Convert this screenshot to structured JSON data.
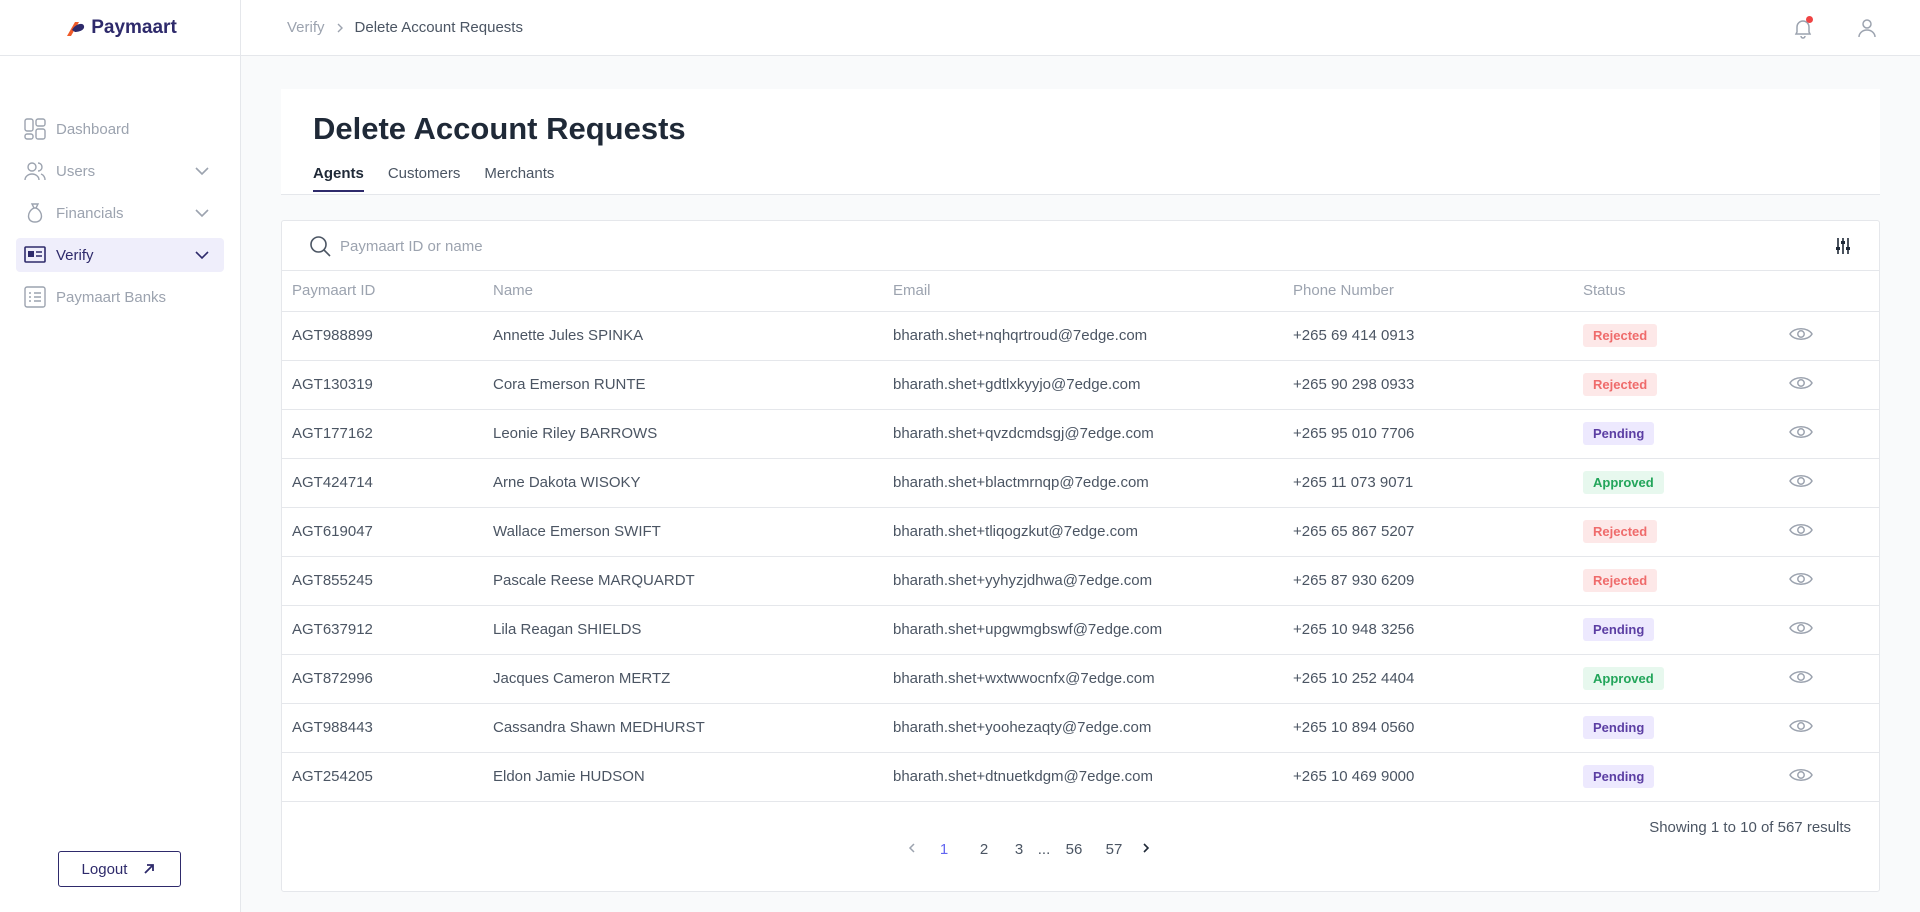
{
  "brand": {
    "name": "Paymaart"
  },
  "sidebar": {
    "items": [
      {
        "label": "Dashboard",
        "icon": "dashboard-icon",
        "has_chevron": false,
        "active": false
      },
      {
        "label": "Users",
        "icon": "users-icon",
        "has_chevron": true,
        "active": false
      },
      {
        "label": "Financials",
        "icon": "money-bag-icon",
        "has_chevron": true,
        "active": false
      },
      {
        "label": "Verify",
        "icon": "id-card-icon",
        "has_chevron": true,
        "active": true
      },
      {
        "label": "Paymaart Banks",
        "icon": "bank-list-icon",
        "has_chevron": false,
        "active": false
      }
    ],
    "logout_label": "Logout"
  },
  "topbar": {
    "breadcrumb": [
      "Verify",
      "Delete Account Requests"
    ]
  },
  "page": {
    "title": "Delete Account Requests",
    "tabs": [
      {
        "label": "Agents",
        "active": true
      },
      {
        "label": "Customers",
        "active": false
      },
      {
        "label": "Merchants",
        "active": false
      }
    ]
  },
  "search": {
    "placeholder": "Paymaart ID or name"
  },
  "table": {
    "headers": [
      "Paymaart ID",
      "Name",
      "Email",
      "Phone Number",
      "Status"
    ],
    "rows": [
      {
        "id": "AGT988899",
        "name": "Annette Jules SPINKA",
        "email": "bharath.shet+nqhqrtroud@7edge.com",
        "phone": "+265 69 414 0913",
        "status": "Rejected"
      },
      {
        "id": "AGT130319",
        "name": "Cora Emerson RUNTE",
        "email": "bharath.shet+gdtlxkyyjo@7edge.com",
        "phone": "+265 90 298 0933",
        "status": "Rejected"
      },
      {
        "id": "AGT177162",
        "name": "Leonie Riley BARROWS",
        "email": "bharath.shet+qvzdcmdsgj@7edge.com",
        "phone": "+265 95 010 7706",
        "status": "Pending"
      },
      {
        "id": "AGT424714",
        "name": "Arne Dakota WISOKY",
        "email": "bharath.shet+blactmrnqp@7edge.com",
        "phone": "+265 11 073 9071",
        "status": "Approved"
      },
      {
        "id": "AGT619047",
        "name": "Wallace Emerson SWIFT",
        "email": "bharath.shet+tliqogzkut@7edge.com",
        "phone": "+265 65 867 5207",
        "status": "Rejected"
      },
      {
        "id": "AGT855245",
        "name": "Pascale Reese MARQUARDT",
        "email": "bharath.shet+yyhyzjdhwa@7edge.com",
        "phone": "+265 87 930 6209",
        "status": "Rejected"
      },
      {
        "id": "AGT637912",
        "name": "Lila Reagan SHIELDS",
        "email": "bharath.shet+upgwmgbswf@7edge.com",
        "phone": "+265 10 948 3256",
        "status": "Pending"
      },
      {
        "id": "AGT872996",
        "name": "Jacques Cameron MERTZ",
        "email": "bharath.shet+wxtwwocnfx@7edge.com",
        "phone": "+265 10 252 4404",
        "status": "Approved"
      },
      {
        "id": "AGT988443",
        "name": "Cassandra Shawn MEDHURST",
        "email": "bharath.shet+yoohezaqty@7edge.com",
        "phone": "+265 10 894 0560",
        "status": "Pending"
      },
      {
        "id": "AGT254205",
        "name": "Eldon Jamie HUDSON",
        "email": "bharath.shet+dtnuetkdgm@7edge.com",
        "phone": "+265 10 469 9000",
        "status": "Pending"
      }
    ]
  },
  "pagination": {
    "pages": [
      "1",
      "2",
      "3",
      "...",
      "56",
      "57"
    ],
    "current": "1",
    "results_text": "Showing 1 to 10 of 567 results"
  },
  "colors": {
    "brand": "#2e2a6b",
    "rejected": "#ef6b6b",
    "pending": "#5b3ea3",
    "approved": "#22a55a",
    "active_page": "#6366f1"
  }
}
